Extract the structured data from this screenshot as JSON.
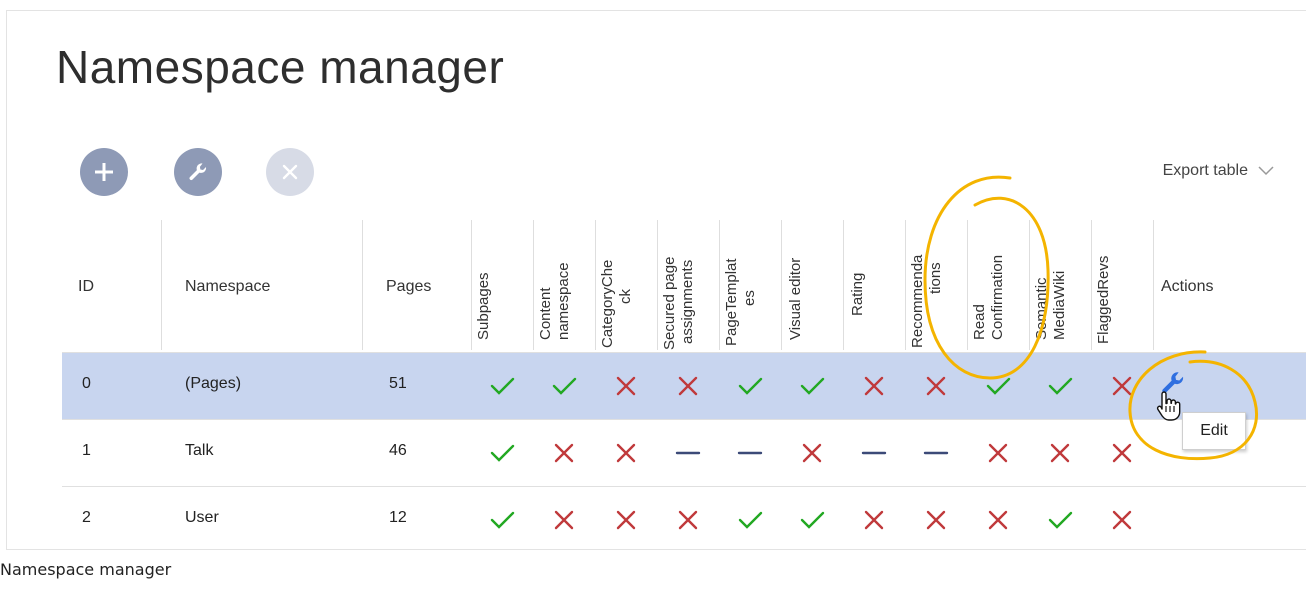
{
  "page": {
    "title": "Namespace manager",
    "caption": "Namespace manager"
  },
  "toolbar": {
    "add_icon": "plus-icon",
    "edit_icon": "wrench-icon",
    "remove_icon": "close-icon",
    "export_label": "Export table",
    "export_icon": "chevron-down-icon"
  },
  "table": {
    "headers": {
      "id": "ID",
      "namespace": "Namespace",
      "pages": "Pages",
      "subpages": "Subpages",
      "content_ns_1": "Content",
      "content_ns_2": "namespace",
      "catcheck_1": "CategoryChe",
      "catcheck_2": "ck",
      "secured_1": "Secured page",
      "secured_2": "assignments",
      "pagetpl_1": "PageTemplat",
      "pagetpl_2": "es",
      "visual_editor": "Visual editor",
      "rating": "Rating",
      "recomm_1": "Recommenda",
      "recomm_2": "tions",
      "readconf_1": "Read",
      "readconf_2": "Confirmation",
      "smw_1": "Semantic",
      "smw_2": "MediaWiki",
      "flaggedrevs": "FlaggedRevs",
      "actions": "Actions"
    },
    "rows": [
      {
        "id": "0",
        "namespace": "(Pages)",
        "pages": "51",
        "flags": [
          "yes",
          "yes",
          "no",
          "no",
          "yes",
          "yes",
          "no",
          "no",
          "yes",
          "yes",
          "no"
        ],
        "selected": true
      },
      {
        "id": "1",
        "namespace": "Talk",
        "pages": "46",
        "flags": [
          "yes",
          "no",
          "no",
          "na",
          "na",
          "no",
          "na",
          "na",
          "no",
          "no",
          "no"
        ],
        "selected": false
      },
      {
        "id": "2",
        "namespace": "User",
        "pages": "12",
        "flags": [
          "yes",
          "no",
          "no",
          "no",
          "yes",
          "yes",
          "no",
          "no",
          "no",
          "yes",
          "no"
        ],
        "selected": false
      }
    ],
    "action_icon": "wrench-icon",
    "tooltip": "Edit"
  },
  "colors": {
    "check": "#22a822",
    "cross": "#c0393b",
    "dash": "#3c4a78",
    "selected_row": "#c8d5ef",
    "highlight": "#f4b400",
    "action_blue": "#2f6fe0"
  }
}
